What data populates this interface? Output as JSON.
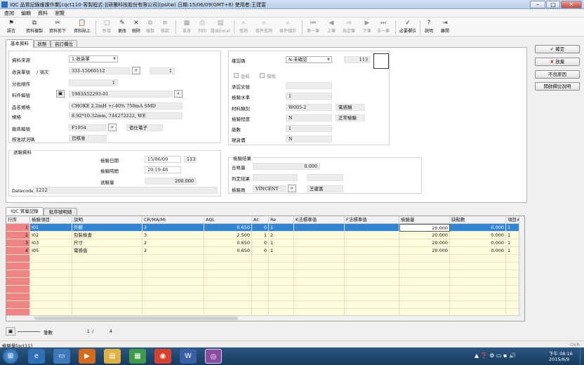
{
  "window": {
    "title": "IQC 品質記錄維護作業[cqct110-客製程式-][研騰科技股份有限公司](psitw)  日期:15/06/09(GMT+8)  使用者:王建富"
  },
  "menu": [
    "查詢",
    "編輯",
    "資料",
    "瀏覽"
  ],
  "toolbar": [
    {
      "label": "語言",
      "icon": "⚑"
    },
    {
      "label": "資料複製",
      "icon": "⧉"
    },
    {
      "label": "資料剪下",
      "icon": "✂"
    },
    {
      "label": "資料貼上",
      "icon": "📋"
    },
    {
      "label": "新增",
      "icon": "□"
    },
    {
      "label": "更改",
      "icon": "✎"
    },
    {
      "label": "刪除",
      "icon": "✕"
    },
    {
      "label": "複製",
      "icon": "⧉"
    },
    {
      "label": "條款",
      "icon": "≡"
    },
    {
      "label": "單身",
      "icon": "▦"
    },
    {
      "label": "列印",
      "icon": "⎙"
    },
    {
      "label": "匯出Excel",
      "icon": "▤"
    },
    {
      "label": "查詢",
      "icon": "⌕"
    },
    {
      "label": "條件查詢",
      "icon": "⌕"
    },
    {
      "label": "條件儲存",
      "icon": "⌕"
    },
    {
      "label": "第一筆",
      "icon": "⏮"
    },
    {
      "label": "上筆",
      "icon": "◀"
    },
    {
      "label": "指定筆",
      "icon": "⇨"
    },
    {
      "label": "下筆",
      "icon": "▶"
    },
    {
      "label": "末一筆",
      "icon": "⏭"
    },
    {
      "label": "必要欄位",
      "icon": "✓"
    },
    {
      "label": "說明",
      "icon": "?"
    },
    {
      "label": "離開",
      "icon": "⇥"
    }
  ],
  "tabs": [
    "基本資料",
    "狀態",
    "自訂欄位"
  ],
  "basic": {
    "source_label": "資料來源",
    "source_value": "1:收貨單",
    "receipt_label": "收貨單號",
    "item_label": "/ 項次",
    "receipt_no": "331-15060112",
    "item_no": "1",
    "batch_label": "分批順序",
    "batch_value": "1",
    "part_label": "料件編號",
    "part_value": "1983A52293-01",
    "name_label": "品名規格",
    "name_value": "CHOKE 2.2mH +/-40% 750mA SMD",
    "spec_label": "規格",
    "spec_value": "8.92*10.32mm, 744272222, WE",
    "vendor_label": "廠商編號",
    "vendor_code": "F1954",
    "vendor_name": "佰仕電子",
    "approve_label": "核准狀況碼",
    "approve_value": "已核准"
  },
  "confirm": {
    "confirm_label": "確認碼",
    "confirm_value": "N:未確認",
    "confirm_code": "113",
    "chk1_label": "急料",
    "chk2_label": "保稅",
    "contract_label": "承認文號",
    "contract_value": "",
    "level_label": "檢驗水準",
    "level_value": "1",
    "material_label": "材料類別",
    "material_value": "W005-2",
    "material_name": "電感類",
    "degree_label": "檢驗程度",
    "degree_value": "N",
    "degree_name": "正常檢驗",
    "count_label": "級數",
    "count_value": "1",
    "lot_label": "現貨價",
    "lot_value": "N"
  },
  "inspect": {
    "group_label": "送驗資料",
    "date_label": "檢驗日期",
    "date_value": "15/06/09",
    "date_code": "113",
    "time_label": "檢驗時間",
    "time_value": "20:19:48",
    "qty_label": "送驗量",
    "qty_value": "200.000",
    "datecode_label": "Datecode",
    "datecode_value": "1212"
  },
  "result": {
    "group_label": "檢驗結果",
    "pass_label": "合格量",
    "pass_value": "0.000",
    "judge_label": "判定結果",
    "judge_value": "",
    "inspector_label": "檢驗員",
    "inspector_code": "VINCENT",
    "inspector_name": "王建富"
  },
  "right_buttons": [
    "確定",
    "放棄",
    "不良原因",
    "開啟欄位說明"
  ],
  "lower_tabs": [
    "IQC 質量記錄",
    "批序號明細"
  ],
  "grid": {
    "headers": [
      "行序",
      "檢驗項目",
      "說明",
      "CR/MA/MI",
      "AQL",
      "Ac",
      "Re",
      "K法標準值",
      "F法標準值",
      "檢驗量",
      "缺點數",
      "項目#"
    ],
    "rows": [
      [
        "1",
        "I01",
        "外觀",
        "2",
        "0.650",
        "0",
        "1",
        "",
        "",
        "20.000",
        "0.000",
        "1"
      ],
      [
        "2",
        "I02",
        "包裝檢查",
        "3",
        "2.500",
        "1",
        "2",
        "",
        "",
        "20.000",
        "0.000",
        "1"
      ],
      [
        "3",
        "I03",
        "尺寸",
        "2",
        "0.650",
        "0",
        "1",
        "",
        "",
        "20.000",
        "0.000",
        "1"
      ],
      [
        "4",
        "I05",
        "電感值",
        "2",
        "0.650",
        "0",
        "1",
        "",
        "",
        "20.000",
        "0.000",
        "1"
      ]
    ]
  },
  "footer": {
    "count_label": "筆數",
    "current": "1",
    "total": "4"
  },
  "status": {
    "left": "檢驗量[qct11]",
    "right": "OVR"
  },
  "taskbar": {
    "time": "下午 08:16",
    "date": "2015/6/9"
  },
  "colors": {
    "selected": "#2f86d6",
    "rowhead": "#f08484",
    "gridfill": "#fffbdc"
  }
}
